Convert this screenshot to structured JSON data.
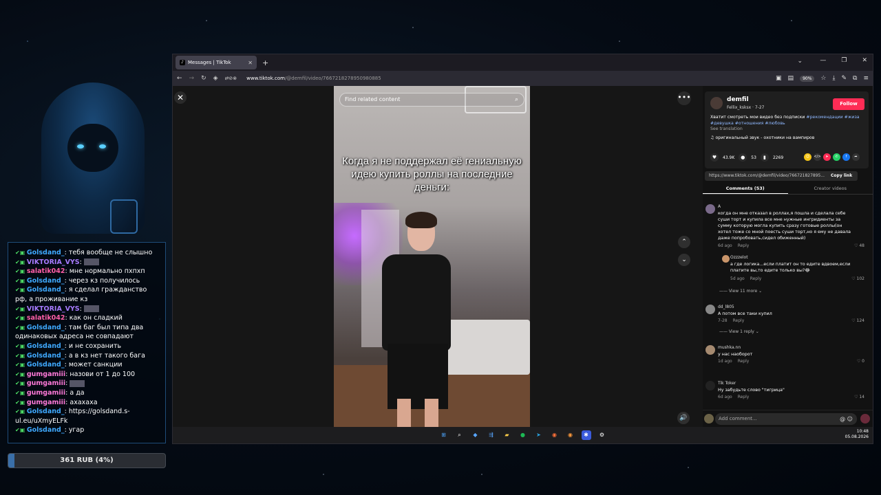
{
  "stream_overlay": {
    "chat": [
      {
        "nick": "Golsdand_",
        "color": "blue",
        "text": "тебя вообще не слышно"
      },
      {
        "nick": "VIKTORIA_VYS",
        "color": "purple",
        "text": "",
        "emote": true
      },
      {
        "nick": "salatik042",
        "color": "pink",
        "text": "мне нормально пхпхп"
      },
      {
        "nick": "Golsdand_",
        "color": "blue",
        "text": "через кз получилось"
      },
      {
        "nick": "Golsdand_",
        "color": "blue",
        "text": "я сделал гражданство рф, а проживание кз"
      },
      {
        "nick": "VIKTORIA_VYS",
        "color": "purple",
        "text": "",
        "emote": true
      },
      {
        "nick": "salatik042",
        "color": "pink",
        "text": "как он сладкий"
      },
      {
        "nick": "Golsdand_",
        "color": "blue",
        "text": "там баг был типа два одинаковых адреса не совпадают"
      },
      {
        "nick": "Golsdand_",
        "color": "blue",
        "text": "и не сохранить"
      },
      {
        "nick": "Golsdand_",
        "color": "blue",
        "text": "а в кз нет такого бага"
      },
      {
        "nick": "Golsdand_",
        "color": "blue",
        "text": "может санкции"
      },
      {
        "nick": "gumgamiii",
        "color": "gum",
        "text": "назови от 1 до 100"
      },
      {
        "nick": "gumgamiii",
        "color": "gum",
        "text": "",
        "emote": true
      },
      {
        "nick": "gumgamiii",
        "color": "gum",
        "text": "а да"
      },
      {
        "nick": "gumgamiii",
        "color": "gum",
        "text": "ахахаха"
      },
      {
        "nick": "Golsdand_",
        "color": "blue",
        "text": "https://golsdand.s-ul.eu/uXmyELFk"
      },
      {
        "nick": "Golsdand_",
        "color": "blue",
        "text": "угар"
      }
    ],
    "donation_goal": {
      "label": "361 RUB (4%)",
      "percent": 4
    }
  },
  "browser": {
    "tab_title": "Messages | TikTok",
    "new_tab": "+",
    "url_domain": "www.tiktok.com",
    "url_path": "/@demfil/video/7667218278950980885",
    "zoom": "90%"
  },
  "tiktok": {
    "search_placeholder": "Find related content",
    "overlay_caption": "Когда я не поддержал её гениальную идею купить роллы на последние деньги:",
    "author": {
      "name": "demfil",
      "sub": "Fellix_ksksx · 7-27"
    },
    "follow_label": "Follow",
    "description": "Хватит смотреть мои видео без подписки",
    "tags": "#рекомендации #жиза #девушка #отношения #любовь",
    "see_translation": "See translation",
    "sound": "оригинальный звук - охотники на вампиров",
    "stats": {
      "likes": "43.9K",
      "comments": "53",
      "saves": "2269"
    },
    "link": "https://www.tiktok.com/@demfil/video/766721827895...",
    "copy_link": "Copy link",
    "tabs": {
      "comments": "Comments (53)",
      "creator_videos": "Creator videos"
    },
    "comments": [
      {
        "name": "А",
        "text": "когда он мне отказал в роллах,я пошла и сделала себе суши торт и купила все мне нужные ингридиенты за сумму которую могла купить сразу готовые роллы(он хотел тоже со мной поесть суши торт,но я ему не давала даже попробовать,сидел обиженный)",
        "time": "6d ago",
        "reply": "Reply",
        "likes": "48"
      },
      {
        "name": "Ozzzelot",
        "text": "а где логика...если платит он то едите вдвоем,если платите вы,то едите только вы?😂",
        "time": "5d ago",
        "reply": "Reply",
        "likes": "102"
      },
      {
        "name": "dd_l805",
        "text": "А потом все таки купил",
        "time": "7-28",
        "reply": "Reply",
        "likes": "124"
      },
      {
        "name": "mushka.nn",
        "text": "у нас наоборот",
        "time": "1d ago",
        "reply": "Reply",
        "likes": "0"
      },
      {
        "name": "Tik Toker",
        "text": "Ну забудьте слово \"тигрица\"",
        "time": "6d ago",
        "reply": "Reply",
        "likes": "14"
      }
    ],
    "view_more_1": "View 11 more",
    "view_reply_1": "View 1 reply",
    "add_comment_placeholder": "Add comment..."
  },
  "taskbar": {
    "time": "10:48",
    "date": "05.08.2026"
  }
}
